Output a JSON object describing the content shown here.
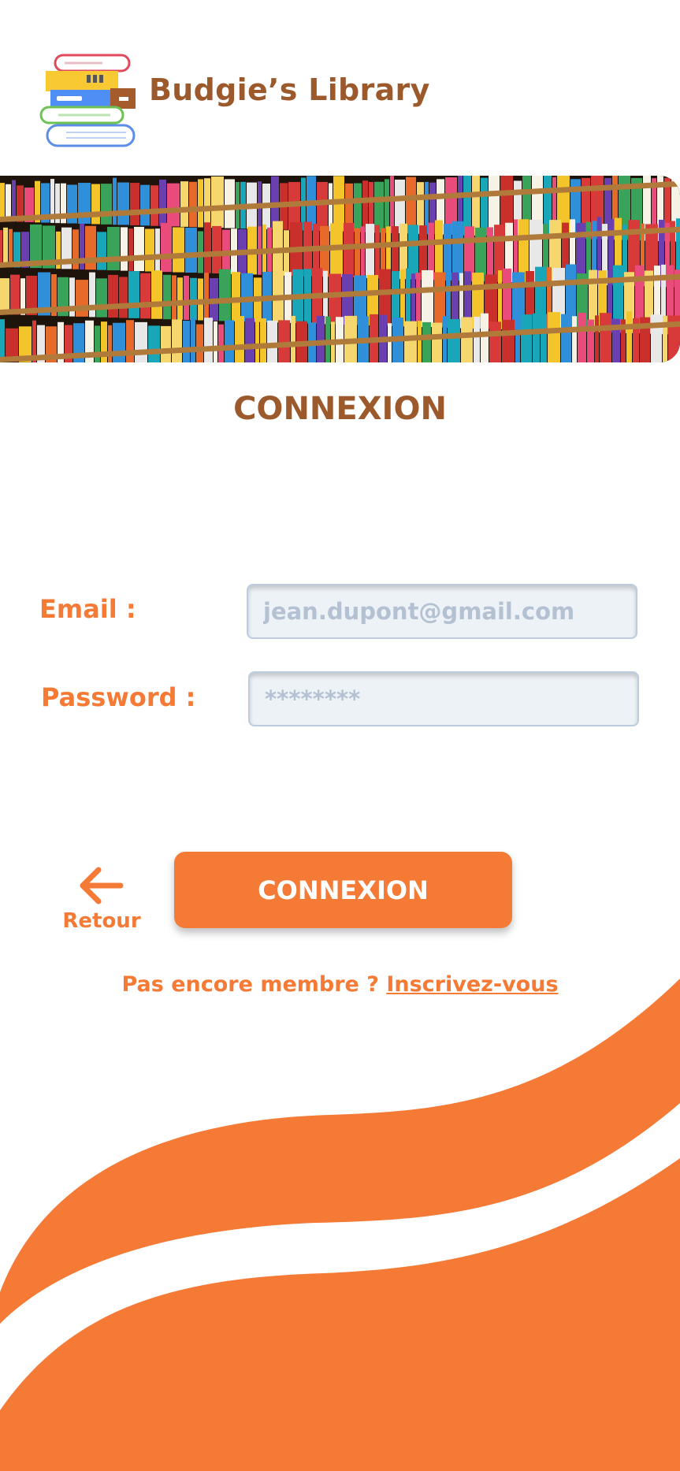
{
  "header": {
    "logo_icon": "book-stack-icon",
    "title": "Budgie’s Library"
  },
  "banner": {
    "image": "library-bookshelf-photo"
  },
  "page": {
    "heading": "CONNEXION"
  },
  "form": {
    "email_label": "Email :",
    "email_placeholder": "jean.dupont@gmail.com",
    "email_value": "",
    "password_label": "Password :",
    "password_placeholder": "********",
    "password_value": ""
  },
  "actions": {
    "back_icon": "arrow-left-icon",
    "back_label": "Retour",
    "submit_label": "CONNEXION"
  },
  "footer": {
    "prompt": "Pas encore membre ? ",
    "signup_link": "Inscrivez-vous"
  },
  "colors": {
    "accent": "#f47a35",
    "brown": "#9c5a2c",
    "input_bg": "#edf2f7",
    "input_border": "#bccbe0"
  }
}
